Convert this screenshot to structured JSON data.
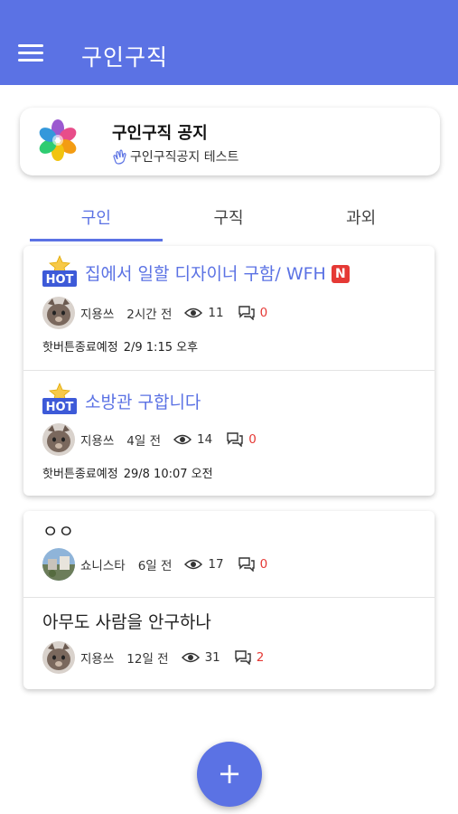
{
  "appbar": {
    "title": "구인구직",
    "menu_icon": "hamburger-menu-icon",
    "color": "#5b72e4"
  },
  "notice": {
    "title": "구인구직 공지",
    "subtitle": "구인구직공지 테스트",
    "logo_icon": "pinwheel-logo-icon",
    "subtitle_icon": "clapping-hands-icon"
  },
  "tabs": [
    {
      "label": "구인",
      "active": true
    },
    {
      "label": "구직",
      "active": false
    },
    {
      "label": "과외",
      "active": false
    }
  ],
  "posts": [
    {
      "hot": true,
      "title": "집에서 일할 디자이너 구함/ WFH",
      "new_badge": "N",
      "author": "지용쓰",
      "time": "2시간 전",
      "views": "11",
      "comments": "0",
      "expire_label": "핫버튼종료예정",
      "expire_date": "2/9 1:15 오후",
      "avatar_icon": "cat-avatar-icon"
    },
    {
      "hot": true,
      "title": "소방관 구합니다",
      "author": "지용쓰",
      "time": "4일 전",
      "views": "14",
      "comments": "0",
      "expire_label": "핫버튼종료예정",
      "expire_date": "29/8 10:07 오전",
      "avatar_icon": "cat-avatar-icon"
    },
    {
      "hot": false,
      "title": "ㅇㅇ",
      "author": "쇼니스타",
      "time": "6일 전",
      "views": "17",
      "comments": "0",
      "avatar_icon": "photo-avatar-icon"
    },
    {
      "hot": false,
      "title": "아무도 사람을 안구하나",
      "author": "지용쓰",
      "time": "12일 전",
      "views": "31",
      "comments": "2",
      "avatar_icon": "cat-avatar-icon"
    }
  ],
  "hot_badge": {
    "label": "HOT",
    "icon": "star-icon"
  },
  "fab": {
    "label": "+",
    "icon": "plus-icon"
  },
  "colors": {
    "accent": "#5b72e4",
    "new_badge": "#e53935",
    "comment_count": "#e53935"
  }
}
